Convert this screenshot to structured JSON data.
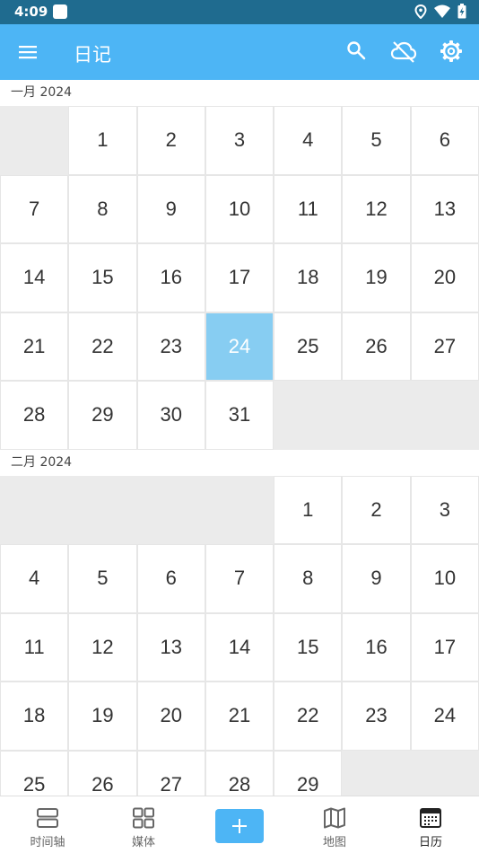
{
  "status": {
    "time": "4:09"
  },
  "app": {
    "title": "日记"
  },
  "colors": {
    "appbar": "#4db5f5",
    "status": "#1f6b8f",
    "today": "#87cdf2"
  },
  "months": [
    {
      "label": "一月 2024",
      "leading_blanks": 1,
      "days": 31,
      "today": 24
    },
    {
      "label": "二月 2024",
      "leading_blanks": 4,
      "days": 29,
      "today": null
    }
  ],
  "nav": {
    "timeline": "时间轴",
    "media": "媒体",
    "add": "+",
    "map": "地图",
    "calendar": "日历"
  },
  "icons": {
    "menu": "menu-icon",
    "search": "search-icon",
    "cloud": "cloud-off-icon",
    "settings": "gear-icon",
    "timeline": "timeline-icon",
    "media": "grid-icon",
    "map": "map-icon",
    "calendar": "calendar-icon"
  }
}
